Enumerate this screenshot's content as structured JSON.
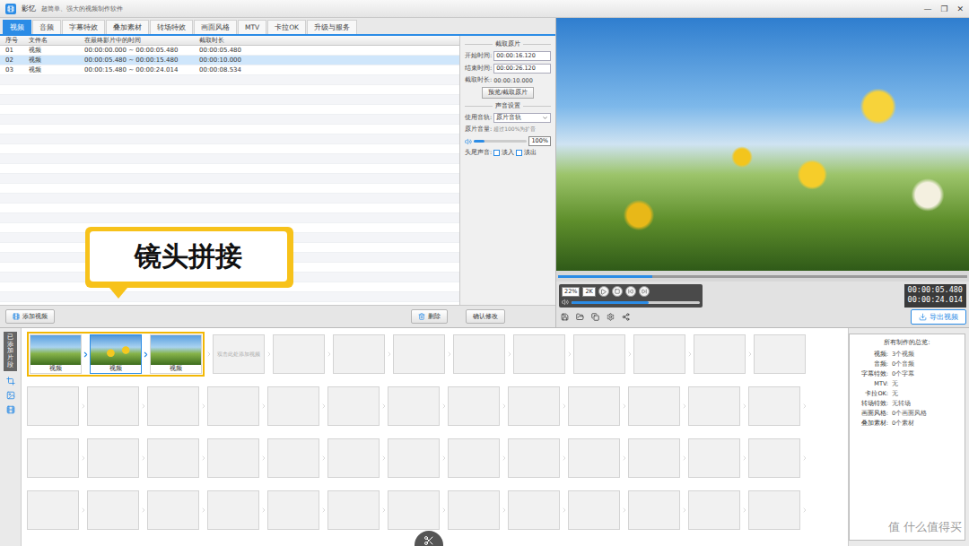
{
  "window": {
    "title": "影忆",
    "subtitle": "超简单、强大的视频制作软件",
    "controls": [
      "—",
      "❐",
      "✕"
    ]
  },
  "tabs": [
    {
      "label": "视频",
      "selected": true
    },
    {
      "label": "音频",
      "selected": false
    },
    {
      "label": "字幕特效",
      "selected": false
    },
    {
      "label": "叠加素材",
      "selected": false
    },
    {
      "label": "转场特效",
      "selected": false
    },
    {
      "label": "画面风格",
      "selected": false
    },
    {
      "label": "MTV",
      "selected": false
    },
    {
      "label": "卡拉OK",
      "selected": false
    },
    {
      "label": "升级与服务",
      "selected": false
    }
  ],
  "clip_table": {
    "columns": [
      "序号",
      "文件名",
      "在最终影片中的时间",
      "截取时长"
    ],
    "rows": [
      {
        "index": "01",
        "name": "视频",
        "range": "00:00:00.000 ~ 00:00:05.480",
        "duration": "00:00:05.480",
        "selected": false
      },
      {
        "index": "02",
        "name": "视频",
        "range": "00:00:05.480 ~ 00:00:15.480",
        "duration": "00:00:10.000",
        "selected": true
      },
      {
        "index": "03",
        "name": "视频",
        "range": "00:00:15.480 ~ 00:00:24.014",
        "duration": "00:00:08.534",
        "selected": false
      }
    ]
  },
  "trim_panel": {
    "section": "截取原片",
    "fields": [
      {
        "label": "开始时间:",
        "value": "00:00:16.120"
      },
      {
        "label": "结束时间:",
        "value": "00:00:26.120"
      }
    ],
    "duration_label": "截取时长:",
    "duration": "00:00:10.000",
    "preview_button": "预览/截取原片"
  },
  "sound_panel": {
    "section": "声音设置",
    "track_label": "使用音轨:",
    "track": "原片音轨",
    "volume_label": "原片音量:",
    "volume_hint": "超过100%为扩音",
    "volume_level": 0.2,
    "volume_reading": "100%",
    "fade_label": "头尾声音:",
    "fades": [
      {
        "label": "淡入",
        "checked": false
      },
      {
        "label": "淡出",
        "checked": false
      }
    ]
  },
  "list_buttons": {
    "add": "添加视频",
    "delete": "删除",
    "confirm": "确认修改"
  },
  "player": {
    "progress": 0.23,
    "zoom": "22%",
    "quality": "2K",
    "volume_level": 0.6,
    "current_time": "00:00:05.480",
    "total_time": "00:00:24.014",
    "export": "导出视频"
  },
  "callout": "镜头拼接",
  "timeline": {
    "side_label": "已添加片段",
    "clips": [
      {
        "label": "视频",
        "selected": false
      },
      {
        "label": "视频",
        "selected": true
      },
      {
        "label": "视频",
        "selected": false
      }
    ],
    "placeholder": "双击此处添加视频"
  },
  "summary": {
    "title": "所有制作的总览:",
    "items": [
      {
        "label": "视频:",
        "value": "3个视频"
      },
      {
        "label": "音频:",
        "value": "0个音频"
      },
      {
        "label": "字幕特效:",
        "value": "0个字幕"
      },
      {
        "label": "MTV:",
        "value": "无"
      },
      {
        "label": "卡拉OK:",
        "value": "无"
      },
      {
        "label": "转场特效:",
        "value": "无转场"
      },
      {
        "label": "画面风格:",
        "value": "0个画面风格"
      },
      {
        "label": "叠加素材:",
        "value": "0个素材"
      }
    ]
  },
  "watermark": "值 什么值得买"
}
